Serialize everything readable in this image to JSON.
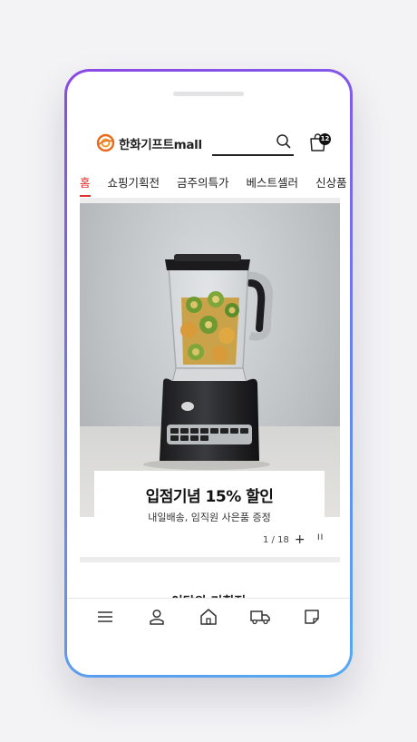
{
  "brand": {
    "logo_text": "한화기프트mall",
    "accent": "#e3312d",
    "logo_color": "#e86a1c"
  },
  "header": {
    "cart_count": "12"
  },
  "tabs": [
    {
      "label": "홈",
      "active": true
    },
    {
      "label": "쇼핑기획전"
    },
    {
      "label": "금주의특가"
    },
    {
      "label": "베스트셀러"
    },
    {
      "label": "신상품"
    }
  ],
  "banner": {
    "title": "입점기념 15% 할인",
    "subtitle": "내일배송, 임직원 사은품 증정",
    "pager": "1 / 18",
    "plus": "+",
    "pause": "II"
  },
  "section": {
    "title": "이달의 기획전"
  },
  "bottom_nav": [
    "menu-icon",
    "user-icon",
    "home-icon",
    "delivery-truck-icon",
    "note-icon"
  ]
}
